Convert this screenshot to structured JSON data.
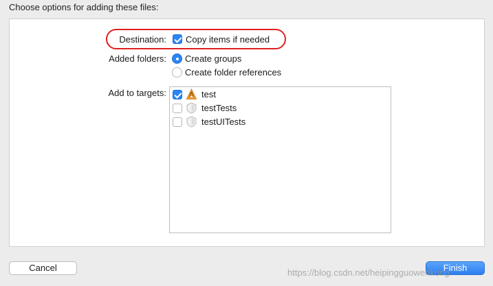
{
  "header": {
    "title": "Choose options for adding these files:"
  },
  "destination": {
    "label": "Destination:",
    "option_label": "Copy items if needed",
    "checked": true
  },
  "added_folders": {
    "label": "Added folders:",
    "options": [
      {
        "label": "Create groups",
        "selected": true
      },
      {
        "label": "Create folder references",
        "selected": false
      }
    ]
  },
  "targets": {
    "label": "Add to targets:",
    "items": [
      {
        "label": "test",
        "checked": true,
        "icon": "app-icon"
      },
      {
        "label": "testTests",
        "checked": false,
        "icon": "test-bundle-icon"
      },
      {
        "label": "testUITests",
        "checked": false,
        "icon": "test-bundle-icon"
      }
    ]
  },
  "buttons": {
    "cancel": "Cancel",
    "finish": "Finish"
  },
  "watermark": "https://blog.csdn.net/heipingguowenkong",
  "colors": {
    "accent": "#2b86f5",
    "highlight": "#e01e1e"
  }
}
